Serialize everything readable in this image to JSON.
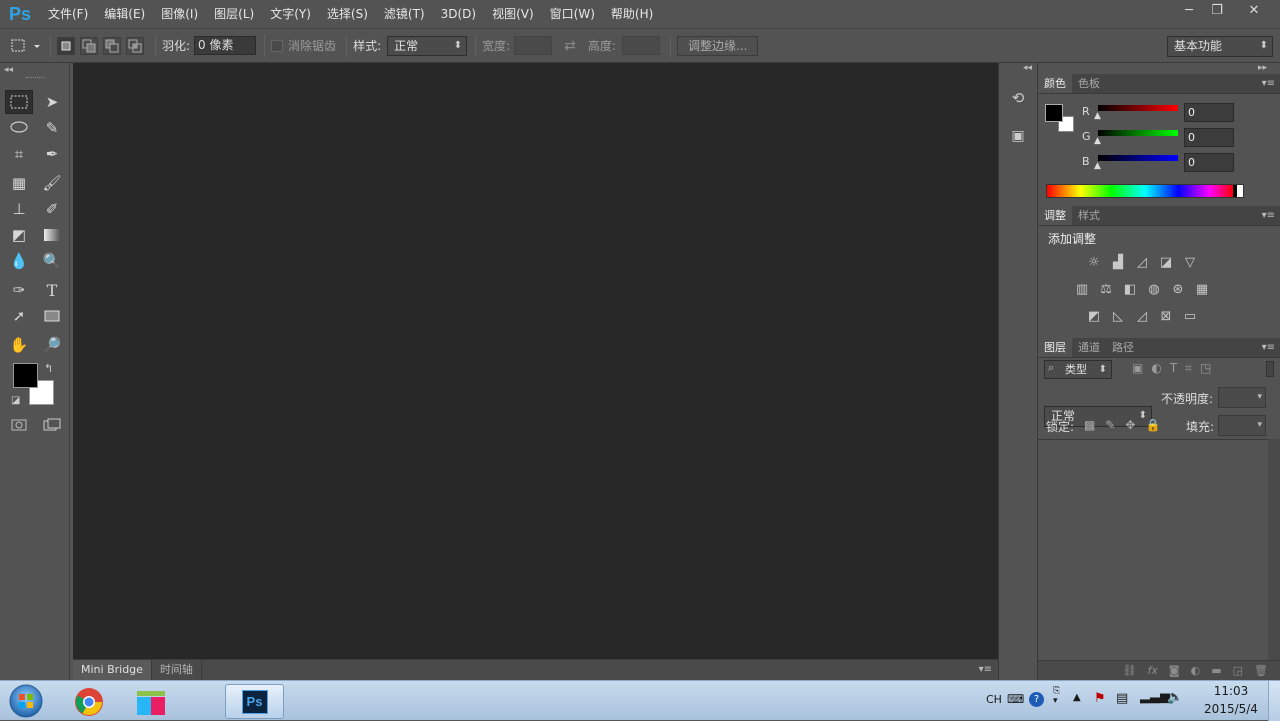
{
  "app": {
    "logo": "Ps"
  },
  "menu": [
    "文件(F)",
    "编辑(E)",
    "图像(I)",
    "图层(L)",
    "文字(Y)",
    "选择(S)",
    "滤镜(T)",
    "3D(D)",
    "视图(V)",
    "窗口(W)",
    "帮助(H)"
  ],
  "window_controls": {
    "minimize": "─",
    "restore": "❐",
    "close": "✕"
  },
  "options": {
    "feather_label": "羽化:",
    "feather_value": "0 像素",
    "antialias_label": "消除锯齿",
    "style_label": "样式:",
    "style_value": "正常",
    "width_label": "宽度:",
    "height_label": "高度:",
    "refine_edge": "调整边缘...",
    "workspace": "基本功能"
  },
  "bottom_tabs": [
    "Mini Bridge",
    "时间轴"
  ],
  "color_panel": {
    "tabs": [
      "颜色",
      "色板"
    ],
    "channels": [
      {
        "label": "R",
        "value": "0",
        "color": "#d00000"
      },
      {
        "label": "G",
        "value": "0",
        "color": "#00b000"
      },
      {
        "label": "B",
        "value": "0",
        "color": "#0000d0"
      }
    ]
  },
  "adjust_panel": {
    "tabs": [
      "调整",
      "样式"
    ],
    "title": "添加调整"
  },
  "layers_panel": {
    "tabs": [
      "图层",
      "通道",
      "路径"
    ],
    "filter_kind": "类型",
    "blend_mode": "正常",
    "opacity_label": "不透明度:",
    "lock_label": "锁定:",
    "fill_label": "填充:"
  },
  "taskbar": {
    "lang": "CH",
    "time": "11:03",
    "date": "2015/5/4"
  },
  "colors": {
    "foreground": "#000000",
    "background": "#ffffff",
    "ps_blue": "#2fa3e6"
  }
}
